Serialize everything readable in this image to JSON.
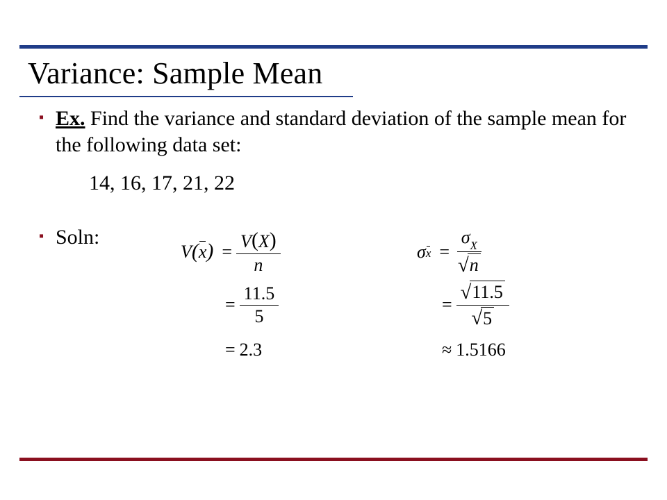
{
  "title": "Variance: Sample Mean",
  "bullets": {
    "ex_label": "Ex.",
    "ex_text": " Find the variance and standard deviation of the sample mean for the following data set:",
    "data_values": "14, 16, 17, 21, 22",
    "soln_label": "Soln:"
  },
  "math": {
    "variance": {
      "lhs_func": "V",
      "lhs_arg": "x",
      "num_func": "V",
      "num_arg": "X",
      "den": "n",
      "step2_num": "11.5",
      "step2_den": "5",
      "result": "2.3"
    },
    "stdev": {
      "sigma": "σ",
      "sub_xbar": "x",
      "num_sigma_sub": "X",
      "den_var": "n",
      "step2_num_radicand": "11.5",
      "step2_den_radicand": "5",
      "result": "1.5166"
    },
    "symbols": {
      "equals": "=",
      "approx": "≈",
      "radical": "√"
    }
  },
  "colors": {
    "top_rule": "#1f3c88",
    "bottom_rule": "#8a0f1f",
    "bullet_marker": "#8a0f1f"
  }
}
